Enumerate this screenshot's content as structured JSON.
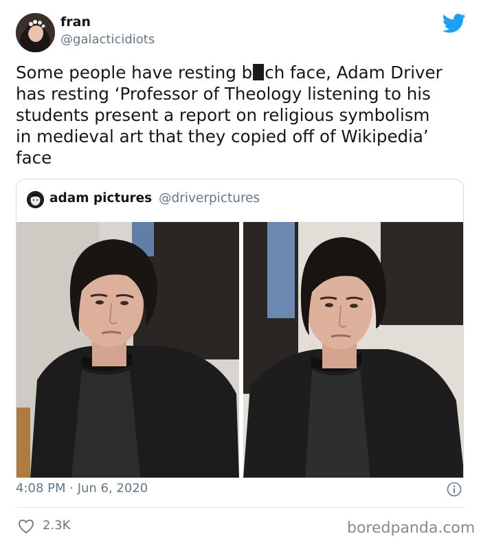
{
  "tweet": {
    "author": {
      "name": "fran",
      "handle": "@galacticidiots"
    },
    "platform_icon": "twitter-bird-icon",
    "text_lines": [
      {
        "before": "Some people have resting b",
        "after": "ch face, Adam Driver"
      },
      "has resting ‘Professor of Theology listening to his",
      "students present a report on religious symbolism",
      "in medieval art that they copied off of Wikipedia’",
      "face"
    ],
    "timestamp": "4:08 PM · Jun 6, 2020",
    "likes": "2.3K"
  },
  "quoted_tweet": {
    "name": "adam pictures",
    "handle": "@driverpictures",
    "images": [
      "photo-left",
      "photo-right"
    ]
  },
  "colors": {
    "twitter_blue": "#1da1f2",
    "secondary_text": "#657786",
    "border": "#cfd9de"
  },
  "watermark": "boredpanda.com"
}
